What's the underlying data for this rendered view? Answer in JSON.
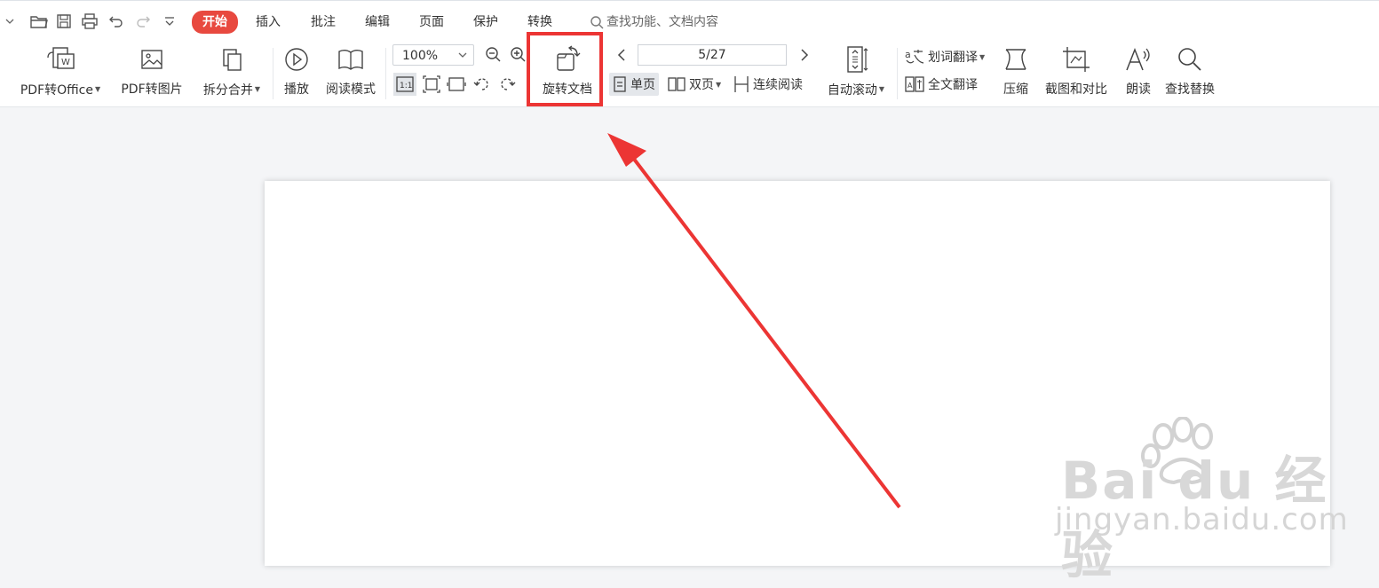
{
  "menu": {
    "tabs": [
      "开始",
      "插入",
      "批注",
      "编辑",
      "页面",
      "保护",
      "转换"
    ],
    "search_placeholder": "查找功能、文档内容"
  },
  "ribbon": {
    "pdf_to_office": "PDF转Office",
    "pdf_to_image": "PDF转图片",
    "split_merge": "拆分合并",
    "play": "播放",
    "read_mode": "阅读模式",
    "zoom_value": "100%",
    "rotate_doc": "旋转文档",
    "page_indicator": "5/27",
    "single_page": "单页",
    "double_page": "双页",
    "continuous_read": "连续阅读",
    "auto_scroll": "自动滚动",
    "word_translate": "划词翻译",
    "full_translate": "全文翻译",
    "compress": "压缩",
    "screenshot_compare": "截图和对比",
    "read_aloud": "朗读",
    "find_replace": "查找替换",
    "actual_size_label": "1:1"
  },
  "watermark": {
    "logo": "Bai du 经验",
    "url": "jingyan.baidu.com"
  },
  "colors": {
    "accent": "#e8493f",
    "highlight_box": "#ec3534",
    "arrow": "#ec3534"
  }
}
